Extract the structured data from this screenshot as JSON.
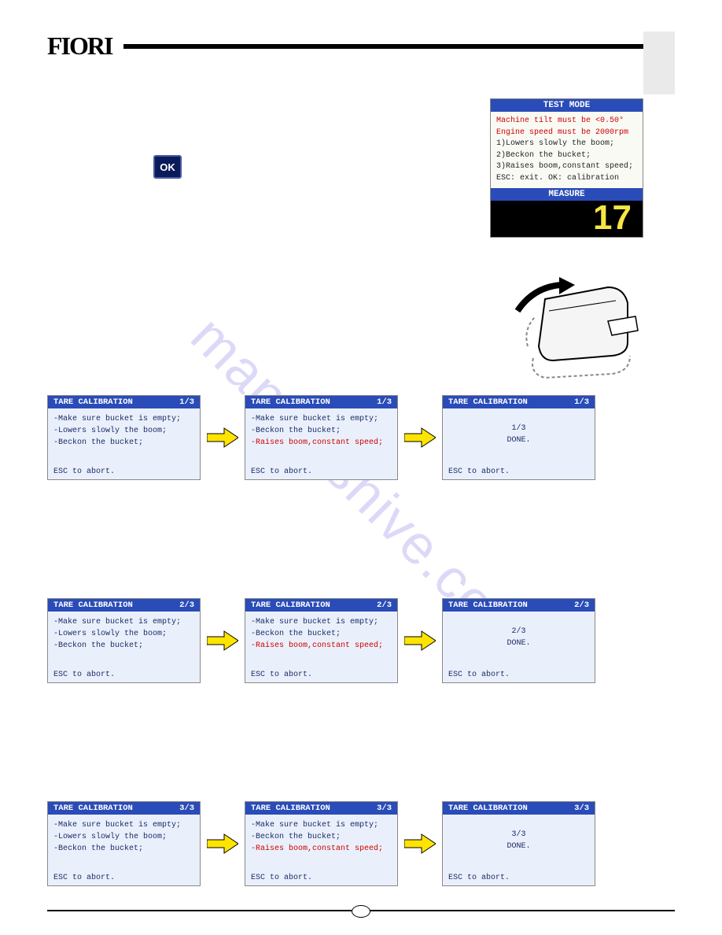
{
  "logo": "FIORI",
  "watermark": "manualshive.com",
  "ok_label": "OK",
  "test_mode": {
    "header": "TEST MODE",
    "lines": [
      {
        "t": "Machine tilt must be <0.50°",
        "red": true
      },
      {
        "t": "Engine speed must be 2000rpm",
        "red": true
      },
      {
        "t": "1)Lowers slowly the boom;",
        "red": false
      },
      {
        "t": "2)Beckon the bucket;",
        "red": false
      },
      {
        "t": "3)Raises boom,constant speed;",
        "red": false
      },
      {
        "t": "ESC: exit. OK: calibration",
        "red": false
      }
    ],
    "measure_label": "MEASURE",
    "measure_value": "17"
  },
  "tare_rows": [
    {
      "step": "1/3",
      "screenA": {
        "title": "TARE CALIBRATION",
        "badge": "1/3",
        "lines": [
          "-Make sure bucket is empty;",
          "-Lowers slowly the boom;",
          "-Beckon the bucket;"
        ],
        "footer": "ESC to abort."
      },
      "screenB": {
        "title": "TARE CALIBRATION",
        "badge": "1/3",
        "lines": [
          "-Make sure bucket is empty;",
          "-Beckon the bucket;"
        ],
        "redline": "-Raises boom,constant speed;",
        "footer": "ESC to abort."
      },
      "screenC": {
        "title": "TARE CALIBRATION",
        "badge": "1/3",
        "center1": "1/3",
        "center2": "DONE.",
        "footer": "ESC to abort."
      }
    },
    {
      "step": "2/3",
      "screenA": {
        "title": "TARE CALIBRATION",
        "badge": "2/3",
        "lines": [
          "-Make sure bucket is empty;",
          "-Lowers slowly the boom;",
          "-Beckon the bucket;"
        ],
        "footer": "ESC to abort."
      },
      "screenB": {
        "title": "TARE CALIBRATION",
        "badge": "2/3",
        "lines": [
          "-Make sure bucket is empty;",
          "-Beckon the bucket;"
        ],
        "redline": "-Raises boom,constant speed;",
        "footer": "ESC to abort."
      },
      "screenC": {
        "title": "TARE CALIBRATION",
        "badge": "2/3",
        "center1": "2/3",
        "center2": "DONE.",
        "footer": "ESC to abort."
      }
    },
    {
      "step": "3/3",
      "screenA": {
        "title": "TARE CALIBRATION",
        "badge": "3/3",
        "lines": [
          "-Make sure bucket is empty;",
          "-Lowers slowly the boom;",
          "-Beckon the bucket;"
        ],
        "footer": "ESC to abort."
      },
      "screenB": {
        "title": "TARE CALIBRATION",
        "badge": "3/3",
        "lines": [
          "-Make sure bucket is empty;",
          "-Beckon the bucket;"
        ],
        "redline": "-Raises boom,constant speed;",
        "footer": "ESC to abort."
      },
      "screenC": {
        "title": "TARE CALIBRATION",
        "badge": "3/3",
        "center1": "3/3",
        "center2": "DONE.",
        "footer": "ESC to abort."
      }
    }
  ]
}
